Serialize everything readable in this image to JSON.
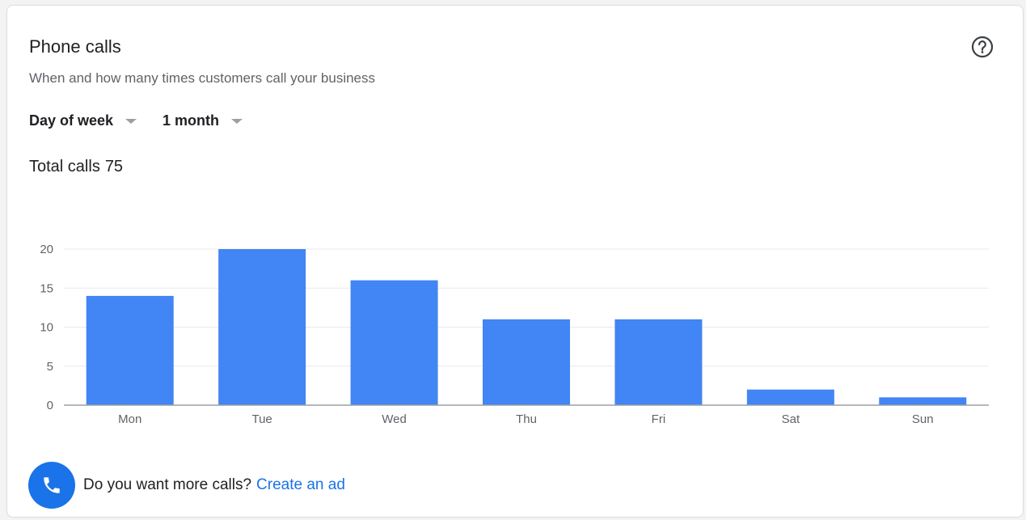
{
  "card": {
    "title": "Phone calls",
    "subtitle": "When and how many times customers call your business",
    "help_icon": "help-circle-icon"
  },
  "filters": {
    "period": "Day of week",
    "range": "1 month"
  },
  "total": {
    "label": "Total calls",
    "value": "75"
  },
  "cta": {
    "icon": "phone-icon",
    "text": "Do you want more calls?",
    "link": "Create an ad"
  },
  "colors": {
    "bar": "#4285f4",
    "accent": "#1a73e8",
    "gridline": "#e8eaed",
    "axis": "#9aa0a6"
  },
  "chart_data": {
    "type": "bar",
    "categories": [
      "Mon",
      "Tue",
      "Wed",
      "Thu",
      "Fri",
      "Sat",
      "Sun"
    ],
    "values": [
      14,
      20,
      16,
      11,
      11,
      2,
      1
    ],
    "yticks": [
      0,
      5,
      10,
      15,
      20
    ],
    "ylim": [
      0,
      20
    ],
    "grid": true,
    "legend": "none"
  }
}
